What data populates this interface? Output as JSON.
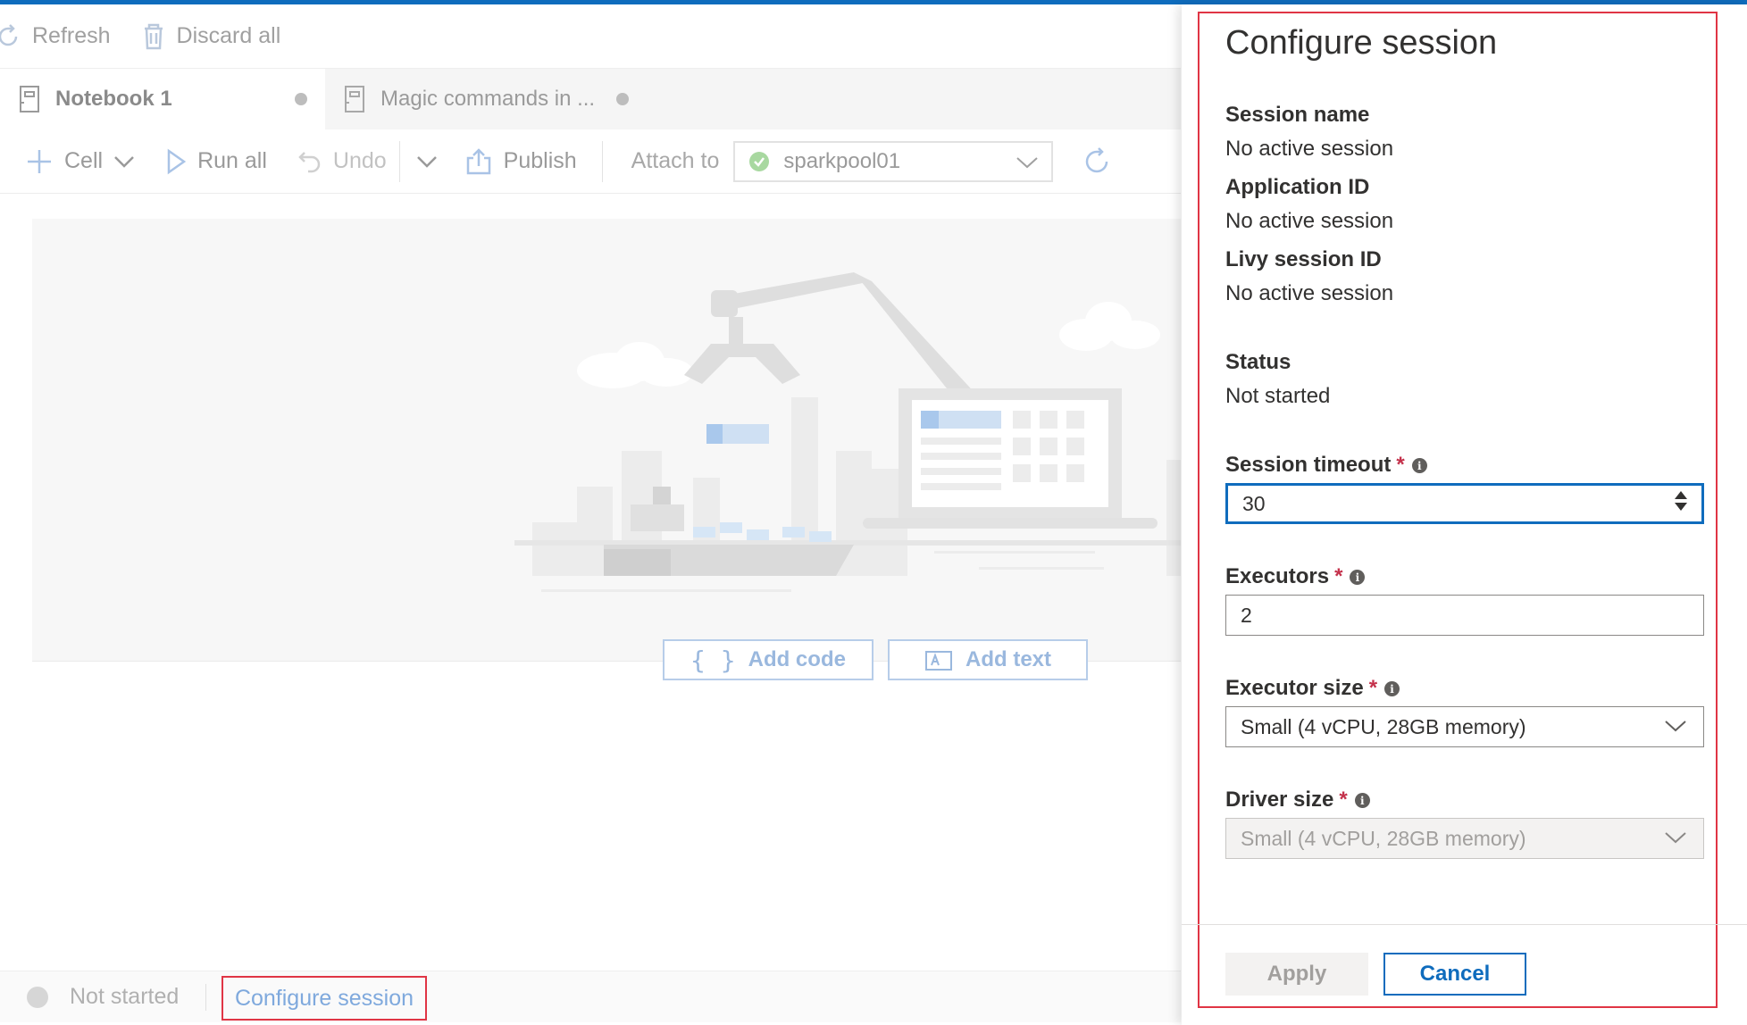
{
  "window": {
    "accent_color": "#0f6cbd"
  },
  "command_bar": {
    "refresh_label": "Refresh",
    "discard_all_label": "Discard all"
  },
  "tabs": [
    {
      "label": "Notebook 1",
      "active": true
    },
    {
      "label": "Magic commands in ...",
      "active": false
    }
  ],
  "toolbar": {
    "cell_label": "Cell",
    "run_all_label": "Run all",
    "undo_label": "Undo",
    "publish_label": "Publish",
    "attach_to_label": "Attach to",
    "pool_value": "sparkpool01"
  },
  "empty_canvas": {
    "add_code_label": "Add code",
    "add_text_label": "Add text"
  },
  "status_bar": {
    "status_text": "Not started",
    "configure_session_link": "Configure session"
  },
  "panel": {
    "title": "Configure session",
    "session_name": {
      "label": "Session name",
      "value": "No active session"
    },
    "application_id": {
      "label": "Application ID",
      "value": "No active session"
    },
    "livy_session_id": {
      "label": "Livy session ID",
      "value": "No active session"
    },
    "status": {
      "label": "Status",
      "value": "Not started"
    },
    "session_timeout": {
      "label": "Session timeout",
      "required": "*",
      "value": "30"
    },
    "executors": {
      "label": "Executors",
      "required": "*",
      "value": "2"
    },
    "executor_size": {
      "label": "Executor size",
      "required": "*",
      "value": "Small (4 vCPU, 28GB memory)"
    },
    "driver_size": {
      "label": "Driver size",
      "required": "*",
      "value": "Small (4 vCPU, 28GB memory)"
    },
    "apply_label": "Apply",
    "cancel_label": "Cancel"
  },
  "colors": {
    "highlight_red": "#e03545",
    "primary_blue": "#0f6cbd",
    "required_red": "#c4314b"
  }
}
